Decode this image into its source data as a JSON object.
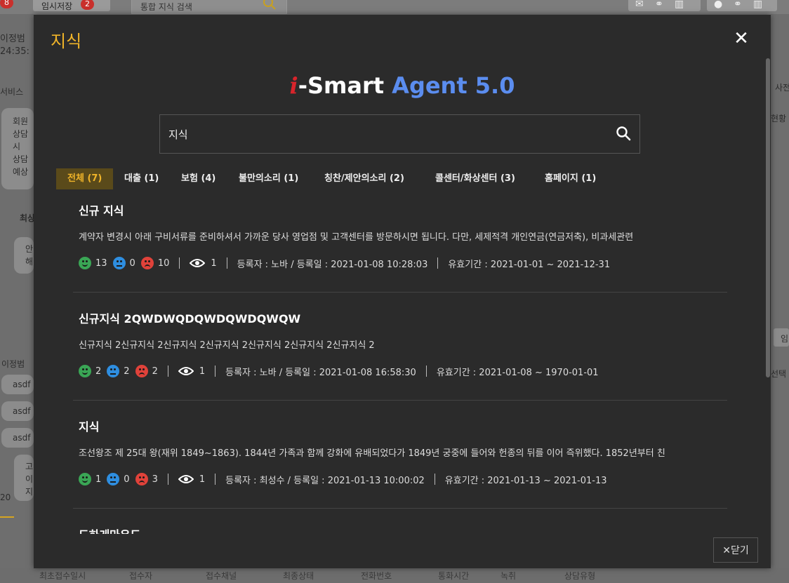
{
  "background": {
    "top_badge_left": "8",
    "temp_save_label": "임시저장",
    "temp_save_count": "2",
    "global_search_placeholder": "통합 지식 검색",
    "left_name": "이정범",
    "left_time": "24:35:",
    "left_section": "서비스",
    "left_recent": "최상",
    "left_chat_name": "이정범",
    "left_bubbles": [
      "asdf",
      "asdf",
      "asdf"
    ],
    "left_number": "20",
    "left_bubble_texts": [
      "회원",
      "상담",
      "시",
      "상담",
      "예상",
      "안",
      "해",
      "고",
      "이",
      "지"
    ],
    "right_tab": "사전",
    "right_text1": "현황",
    "right_text2": "임",
    "right_text3": "선택",
    "bottom_columns": [
      "최초접수일시",
      "접수자",
      "접수채널",
      "최종상태",
      "전화번호",
      "통화시간",
      "녹취",
      "상담유형"
    ]
  },
  "modal": {
    "title": "지식",
    "brand_i": "i",
    "brand_smart": "-Smart",
    "brand_agent": "Agent 5.0",
    "search_value": "지식",
    "close_label": "닫기"
  },
  "tabs": [
    {
      "label": "전체 (7)",
      "active": true
    },
    {
      "label": "대출 (1)"
    },
    {
      "label": "보험 (4)"
    },
    {
      "label": "불만의소리 (1)"
    },
    {
      "label": "칭찬/제안의소리 (2)"
    },
    {
      "label": "콜센터/화상센터 (3)"
    },
    {
      "label": "홈페이지 (1)"
    }
  ],
  "results": [
    {
      "title": "신규 지식",
      "desc": "계약자 변경시 아래 구비서류를 준비하셔서 가까운 당사 영업점 및 고객센터를 방문하시면 됩니다. 다만, 세제적격 개인연금(연금저축), 비과세관련",
      "good": "13",
      "neutral": "0",
      "bad": "10",
      "views": "1",
      "registrar": "등록자 : 노바 / 등록일 : 2021-01-08 10:28:03",
      "validity": "유효기간 : 2021-01-01 ~ 2021-12-31"
    },
    {
      "title": "신규지식 2QWDWQDQWDQWDQWQW",
      "desc": "신규지식 2신규지식 2신규지식 2신규지식 2신규지식 2신규지식 2신규지식 2",
      "good": "2",
      "neutral": "2",
      "bad": "2",
      "views": "1",
      "registrar": "등록자 : 노바 / 등록일 : 2021-01-08 16:58:30",
      "validity": "유효기간 : 2021-01-08 ~ 1970-01-01"
    },
    {
      "title": "지식",
      "desc": "조선왕조 제 25대 왕(재위 1849~1863). 1844년 가족과 함께 강화에 유배되었다가 1849년 궁중에 들어와 헌종의 뒤를 이어 즉위했다. 1852년부터 친",
      "good": "1",
      "neutral": "0",
      "bad": "3",
      "views": "1",
      "registrar": "등록자 : 최성수 / 등록일 : 2021-01-13 10:00:02",
      "validity": "유효기간 : 2021-01-13 ~ 2021-01-13"
    },
    {
      "title": "도하게마우도"
    }
  ]
}
